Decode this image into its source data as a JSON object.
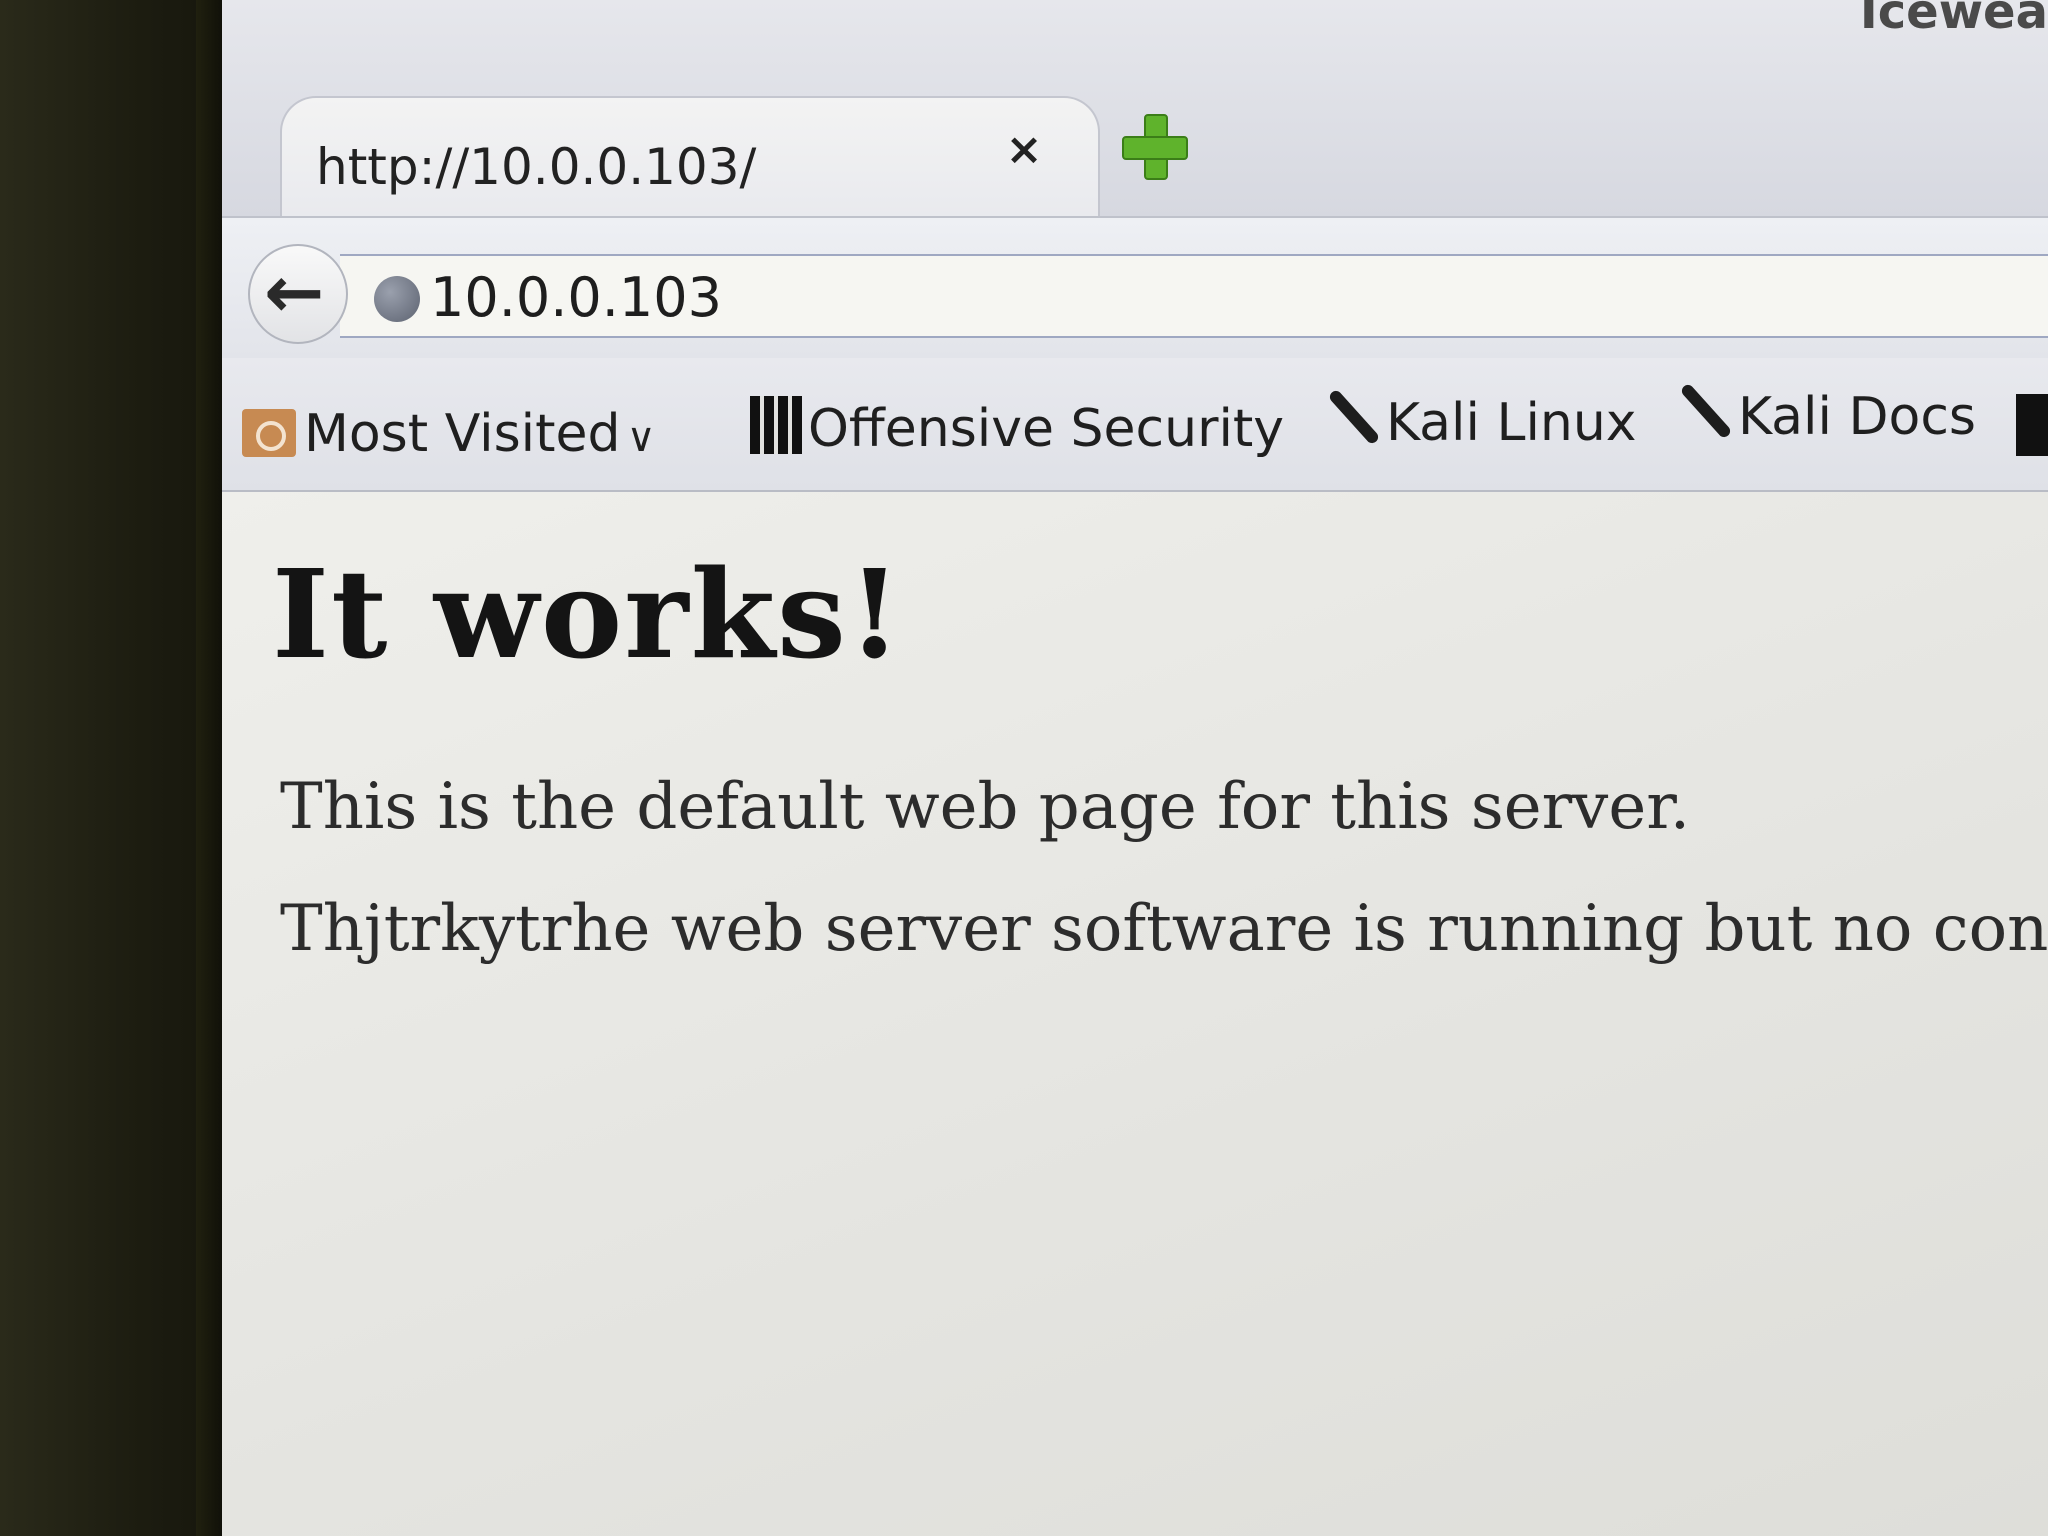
{
  "window": {
    "title": "Icewea"
  },
  "tab": {
    "title": "http://10.0.0.103/",
    "close_icon": "×"
  },
  "navbar": {
    "url": "10.0.0.103"
  },
  "bookmarks": [
    {
      "label": "Most Visited",
      "icon": "folder-icon"
    },
    {
      "label": "Offensive Security",
      "icon": "offsec-icon"
    },
    {
      "label": "Kali Linux",
      "icon": "kali-dragon-icon"
    },
    {
      "label": "Kali Docs",
      "icon": "kali-dragon-icon"
    }
  ],
  "page": {
    "heading": "It works!",
    "paragraphs": [
      "This is the default web page for this server.",
      "Thjtrkytrhe web server software is running but no cont"
    ]
  },
  "colors": {
    "new_tab_plus": "#5fb32c",
    "content_background": "#e4e4e0"
  }
}
